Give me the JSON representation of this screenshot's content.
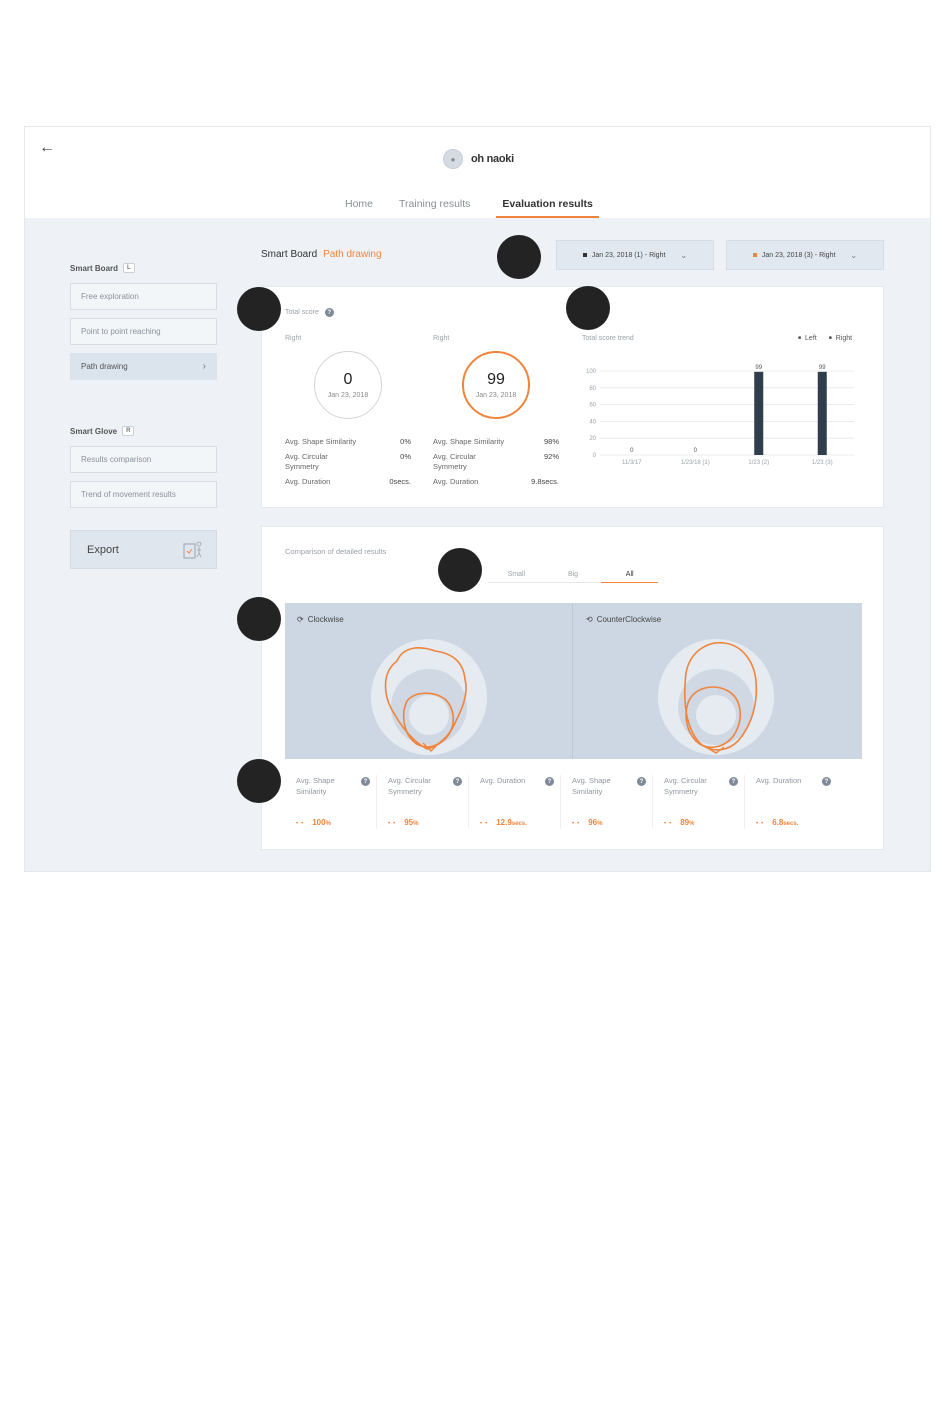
{
  "header": {
    "back_icon": "arrow-left-icon",
    "user_name": "oh naoki",
    "tabs": [
      {
        "label": "Home",
        "active": false
      },
      {
        "label": "Training results",
        "active": false
      },
      {
        "label": "Evaluation results",
        "active": true
      }
    ]
  },
  "sidebar": {
    "smart_board": {
      "title": "Smart Board",
      "tag": "L"
    },
    "board_items": [
      {
        "label": "Free exploration",
        "active": false
      },
      {
        "label": "Point to point reaching",
        "active": false
      },
      {
        "label": "Path drawing",
        "active": true
      }
    ],
    "smart_glove": {
      "title": "Smart Glove",
      "tag": "R"
    },
    "glove_items": [
      {
        "label": "Results comparison",
        "active": false
      },
      {
        "label": "Trend of movement results",
        "active": false
      }
    ],
    "export_label": "Export"
  },
  "breadcrumb": {
    "section": "Smart Board",
    "page": "Path drawing"
  },
  "selectors": [
    {
      "label": "Jan 23, 2018 (1) - Right",
      "color": "#333333"
    },
    {
      "label": "Jan 23, 2018 (3) - Right",
      "color": "#f0843c"
    }
  ],
  "total_score": {
    "title": "Total score",
    "left_col": {
      "side": "Right",
      "score": "0",
      "date": "Jan 23, 2018",
      "metrics": [
        {
          "label": "Avg. Shape Similarity",
          "value": "0%"
        },
        {
          "label": "Avg. Circular Symmetry",
          "value": "0%"
        },
        {
          "label": "Avg. Duration",
          "value": "0secs."
        }
      ]
    },
    "right_col": {
      "side": "Right",
      "score": "99",
      "date": "Jan 23, 2018",
      "metrics": [
        {
          "label": "Avg. Shape Similarity",
          "value": "98%"
        },
        {
          "label": "Avg. Circular Symmetry",
          "value": "92%"
        },
        {
          "label": "Avg. Duration",
          "value": "9.8secs."
        }
      ]
    }
  },
  "trend": {
    "title": "Total score trend",
    "legend": [
      "Left",
      "Right"
    ]
  },
  "chart_data": {
    "type": "bar",
    "title": "Total score trend",
    "categories": [
      "11/3/17",
      "1/23/18 (1)",
      "1/23 (2)",
      "1/23 (3)"
    ],
    "series": [
      {
        "name": "Right",
        "values": [
          0,
          0,
          99,
          99
        ]
      }
    ],
    "ylim": [
      0,
      100
    ],
    "yticks": [
      0,
      20,
      40,
      60,
      80,
      100
    ],
    "grid": true,
    "legend_position": "top-right"
  },
  "comparison": {
    "title": "Comparison of detailed results",
    "tabs": [
      {
        "label": "Small",
        "active": false
      },
      {
        "label": "Big",
        "active": false
      },
      {
        "label": "All",
        "active": true
      }
    ],
    "clockwise": {
      "label": "Clockwise",
      "icon": "rotate-clockwise-icon",
      "stats": [
        {
          "label": "Avg. Shape Similarity",
          "value": "100",
          "unit": "%"
        },
        {
          "label": "Avg. Circular Symmetry",
          "value": "95",
          "unit": "%"
        },
        {
          "label": "Avg. Duration",
          "value": "12.9",
          "unit": "secs."
        }
      ]
    },
    "counterclockwise": {
      "label": "CounterClockwise",
      "icon": "rotate-counterclockwise-icon",
      "stats": [
        {
          "label": "Avg. Shape Similarity",
          "value": "96",
          "unit": "%"
        },
        {
          "label": "Avg. Circular Symmetry",
          "value": "89",
          "unit": "%"
        },
        {
          "label": "Avg. Duration",
          "value": "6.8",
          "unit": "secs."
        }
      ]
    }
  },
  "colors": {
    "accent": "#f0843c",
    "bar": "#2f3d4c",
    "panel": "#cdd7e3"
  }
}
